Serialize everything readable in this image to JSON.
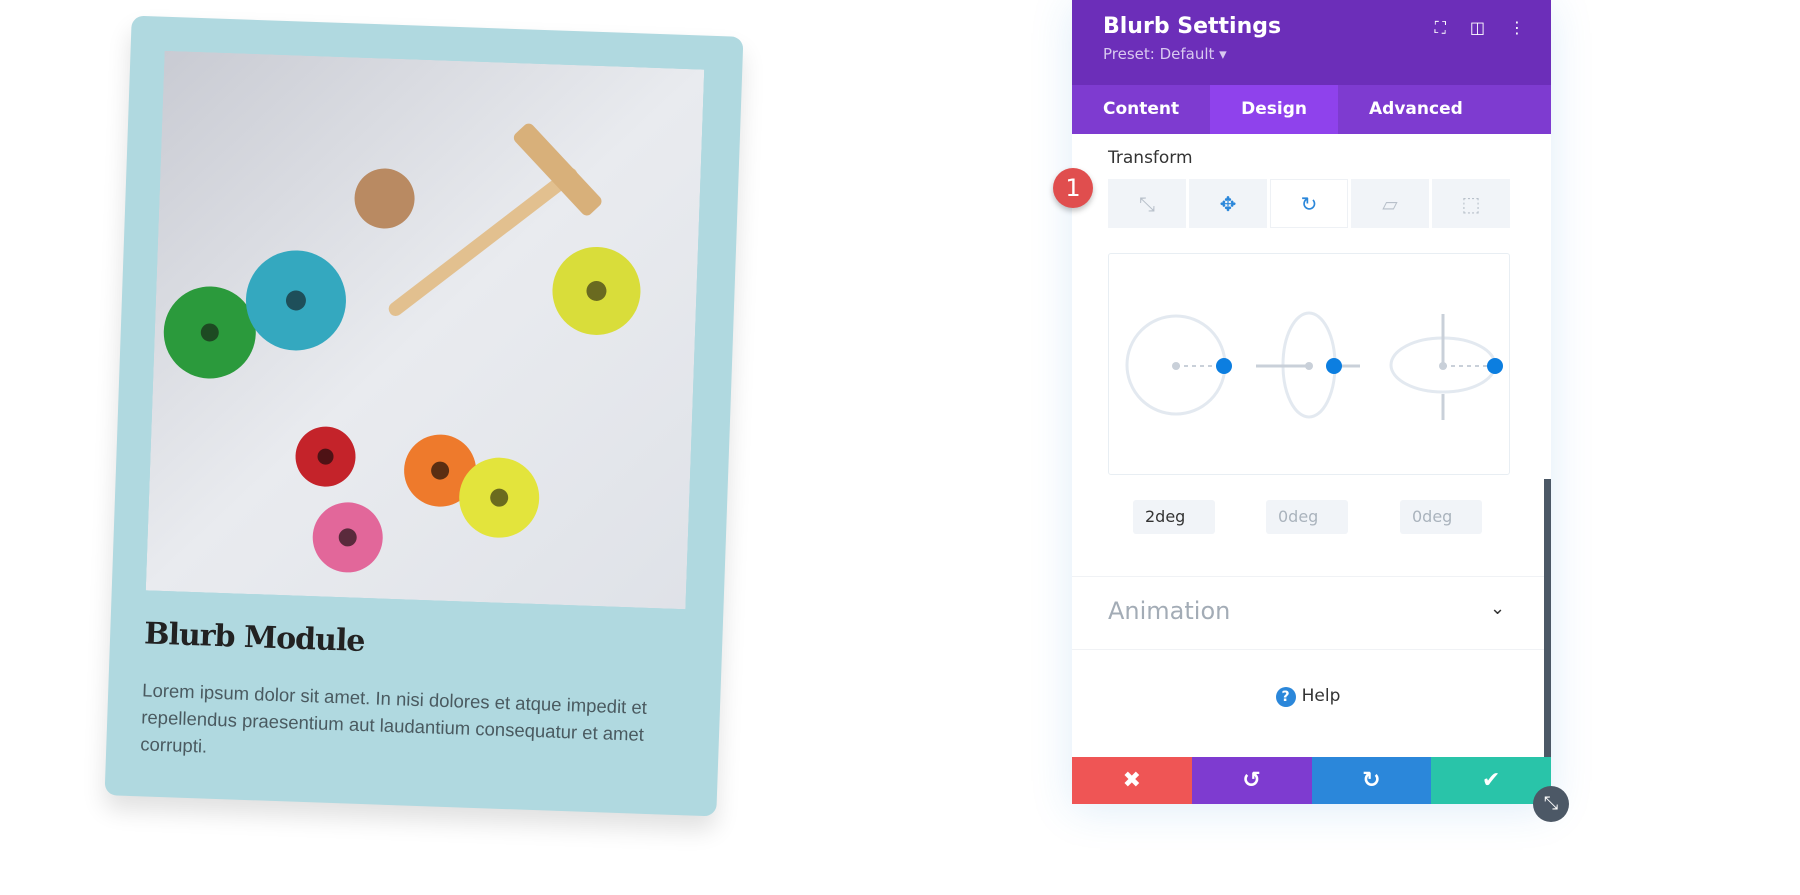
{
  "card": {
    "title": "Blurb Module",
    "body": "Lorem ipsum dolor sit amet. In nisi dolores et atque impedit et repellendus praesentium aut laudantium consequatur et amet corrupti.",
    "background": "#b0d9e0"
  },
  "panel": {
    "title": "Blurb Settings",
    "preset": "Preset: Default ▾",
    "tabs": [
      {
        "label": "Content"
      },
      {
        "label": "Design",
        "active": true
      },
      {
        "label": "Advanced"
      }
    ],
    "section_label": "Transform",
    "transform_buttons": [
      "scale-icon",
      "translate-icon",
      "rotate-icon",
      "skew-icon",
      "origin-icon"
    ],
    "active_transform": "rotate",
    "rotate_values": {
      "x": "2deg",
      "y": "0deg",
      "z": "0deg"
    },
    "animation_label": "Animation",
    "help_label": "Help",
    "footer": {
      "colors": {
        "cancel": "#ef5555",
        "undo": "#7e3bd0",
        "redo": "#2b87da",
        "save": "#29c4a9"
      }
    }
  },
  "step_badge": "1",
  "colors": {
    "header": "#6c2eb9",
    "accent": "#2b87da"
  }
}
